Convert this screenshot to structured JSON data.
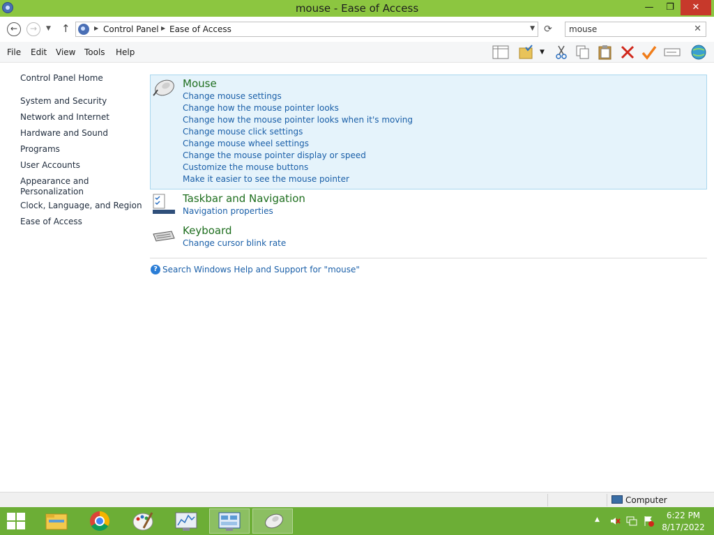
{
  "window": {
    "title": "mouse - Ease of Access",
    "minimize_glyph": "—",
    "maximize_glyph": "❐",
    "close_glyph": "✕"
  },
  "address": {
    "crumbs": [
      "Control Panel",
      "Ease of Access"
    ],
    "search_value": "mouse"
  },
  "menu": [
    "File",
    "Edit",
    "View",
    "Tools",
    "Help"
  ],
  "toolbar_icons": [
    "layout-icon",
    "folder-check-icon",
    "dropdown-icon",
    "cut-icon",
    "copy-icon",
    "paste-icon",
    "delete-icon",
    "checkmark-icon",
    "rename-icon",
    "globe-icon"
  ],
  "sidebar": {
    "home": "Control Panel Home",
    "items": [
      "System and Security",
      "Network and Internet",
      "Hardware and Sound",
      "Programs",
      "User Accounts",
      "Appearance and Personalization",
      "Clock, Language, and Region",
      "Ease of Access"
    ]
  },
  "results": [
    {
      "title": "Mouse",
      "icon": "mouse-icon",
      "links": [
        "Change mouse settings",
        "Change how the mouse pointer looks",
        "Change how the mouse pointer looks when it's moving",
        "Change mouse click settings",
        "Change mouse wheel settings",
        "Change the mouse pointer display or speed",
        "Customize the mouse buttons",
        "Make it easier to see the mouse pointer"
      ]
    },
    {
      "title": "Taskbar and Navigation",
      "icon": "taskbar-icon",
      "links": [
        "Navigation properties"
      ]
    },
    {
      "title": "Keyboard",
      "icon": "keyboard-icon",
      "links": [
        "Change cursor blink rate"
      ]
    }
  ],
  "help_link": "Search Windows Help and Support for \"mouse\"",
  "status": {
    "location": "Computer"
  },
  "taskbar": {
    "apps": [
      "file-explorer-icon",
      "chrome-icon",
      "paint-icon",
      "performance-monitor-icon",
      "control-panel-icon",
      "mouse-icon"
    ],
    "active_app": "control-panel-icon",
    "tray_icons": [
      "show-hidden-icons-icon",
      "volume-muted-icon",
      "network-icon",
      "action-center-icon"
    ],
    "time": "6:22 PM",
    "date": "8/17/2022"
  },
  "colors": {
    "title_bar": "#8cc640",
    "taskbar": "#6cae36",
    "link": "#1a5fa8",
    "result_title": "#1e6e1e",
    "selection_bg": "#e5f3fb"
  }
}
